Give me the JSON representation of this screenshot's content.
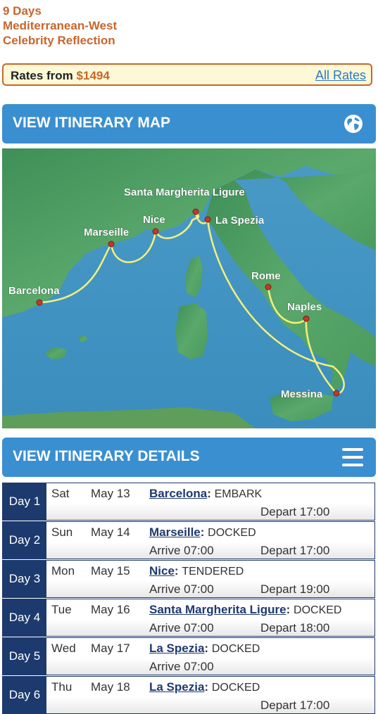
{
  "header": {
    "duration": "9 Days",
    "region": "Mediterranean-West",
    "ship": "Celebrity Reflection"
  },
  "rates": {
    "label": "Rates from",
    "price": "$1494",
    "all_rates": "All Rates"
  },
  "map_section": {
    "label": "VIEW ITINERARY MAP",
    "icon": "globe-icon"
  },
  "map": {
    "ports": [
      "Santa Margherita Ligure",
      "Nice",
      "La Spezia",
      "Marseille",
      "Barcelona",
      "Rome",
      "Naples",
      "Messina"
    ]
  },
  "details_section": {
    "label": "VIEW ITINERARY DETAILS",
    "icon": "menu-icon"
  },
  "itinerary": [
    {
      "day": "Day 1",
      "weekday": "Sat",
      "date": "May 13",
      "port": "Barcelona",
      "status": "EMBARK",
      "arrive": "",
      "depart": "Depart 17:00"
    },
    {
      "day": "Day 2",
      "weekday": "Sun",
      "date": "May 14",
      "port": "Marseille",
      "status": "DOCKED",
      "arrive": "Arrive 07:00",
      "depart": "Depart 17:00"
    },
    {
      "day": "Day 3",
      "weekday": "Mon",
      "date": "May 15",
      "port": "Nice",
      "status": "TENDERED",
      "arrive": "Arrive 07:00",
      "depart": "Depart 19:00"
    },
    {
      "day": "Day 4",
      "weekday": "Tue",
      "date": "May 16",
      "port": "Santa Margherita Ligure",
      "status": "DOCKED",
      "arrive": "Arrive 07:00",
      "depart": "Depart 18:00"
    },
    {
      "day": "Day 5",
      "weekday": "Wed",
      "date": "May 17",
      "port": "La Spezia",
      "status": "DOCKED",
      "arrive": "Arrive 07:00",
      "depart": ""
    },
    {
      "day": "Day 6",
      "weekday": "Thu",
      "date": "May 18",
      "port": "La Spezia",
      "status": "DOCKED",
      "arrive": "",
      "depart": "Depart 17:00"
    }
  ],
  "colors": {
    "accent": "#c8662a",
    "bar": "#3a8fd0",
    "day_cell": "#1d3a6e",
    "rates_bg": "#fdf9d6",
    "sea": "#3f93c0",
    "land": "#4f9e63",
    "route": "#f3f07a"
  }
}
